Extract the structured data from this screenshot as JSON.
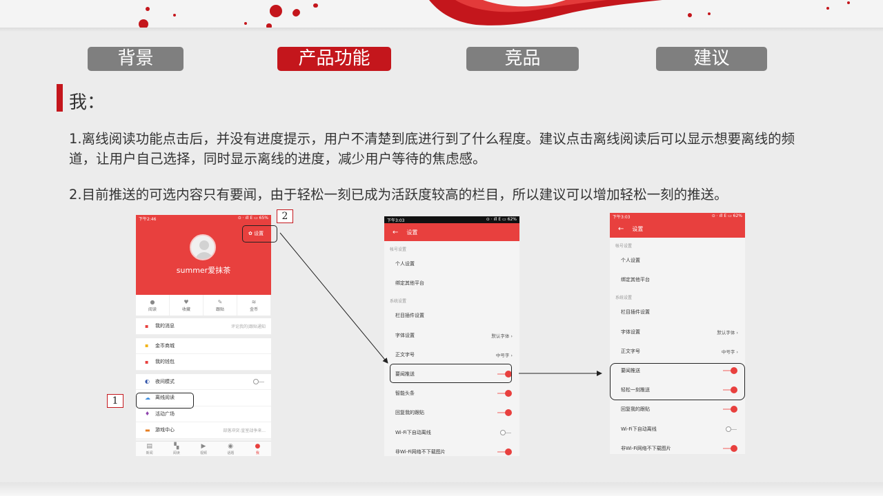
{
  "nav": {
    "tabs": [
      {
        "label": "背景"
      },
      {
        "label": "产品功能"
      },
      {
        "label": "竞品"
      },
      {
        "label": "建议"
      }
    ]
  },
  "section": {
    "title": "我：",
    "paragraphs": [
      "1.离线阅读功能点击后，并没有进度提示，用户不清楚到底进行到了什么程度。建议点击离线阅读后可以显示想要离线的频道，让用户自己选择，同时显示离线的进度，减少用户等待的焦虑感。",
      "2.目前推送的可选内容只有要闻，由于轻松一刻已成为活跃度较高的栏目，所以建议可以增加轻松一刻的推送。"
    ]
  },
  "callouts": {
    "one": "1",
    "two": "2"
  },
  "phone1": {
    "status_left": "下午2:46",
    "status_right": "⊙ ⋅ ıll E ▭ 65%",
    "username": "summer爱抹茶",
    "settings_label": "✿ 设置",
    "quick": [
      {
        "icon": "●",
        "label": "阅读"
      },
      {
        "icon": "♥",
        "label": "收藏"
      },
      {
        "icon": "✎",
        "label": "跟贴"
      },
      {
        "icon": "≋",
        "label": "金币"
      }
    ],
    "menu": [
      {
        "icon": "▪",
        "label": "我的消息",
        "right": "评论我的|跟贴通知"
      },
      {
        "icon": "▪",
        "label": "金币商城",
        "right": ""
      },
      {
        "icon": "▪",
        "label": "我的钱包",
        "right": ""
      },
      {
        "icon": "◐",
        "label": "夜间模式",
        "right": ""
      },
      {
        "icon": "☁",
        "label": "离线阅读",
        "right": ""
      },
      {
        "icon": "♦",
        "label": "活动广场",
        "right": ""
      },
      {
        "icon": "▬",
        "label": "游戏中心",
        "right": "部落冲突:皇室战争来..."
      }
    ],
    "bottom_nav": [
      {
        "icon": "▤",
        "label": "新闻"
      },
      {
        "icon": "▚",
        "label": "阅读"
      },
      {
        "icon": "▶",
        "label": "视频"
      },
      {
        "icon": "◉",
        "label": "话题"
      },
      {
        "icon": "●",
        "label": "我"
      }
    ]
  },
  "phone2": {
    "status_left": "下午3:03",
    "status_right": "⊙ ⋅ ıll E ▭ 62%",
    "title": "设置",
    "group1": "帐号设置",
    "group2": "系统设置",
    "items": [
      {
        "label": "个人设置",
        "right": ""
      },
      {
        "label": "绑定其他平台",
        "right": ""
      },
      {
        "label": "栏目插件设置",
        "right": ""
      },
      {
        "label": "字体设置",
        "right": "默认字体 ›"
      },
      {
        "label": "正文字号",
        "right": "中号字 ›"
      },
      {
        "label": "要闻推送",
        "right": ""
      },
      {
        "label": "智能头条",
        "right": ""
      },
      {
        "label": "回复我的跟贴",
        "right": ""
      },
      {
        "label": "Wi-Fi下自动离线",
        "right": ""
      },
      {
        "label": "非Wi-Fi网络不下载图片",
        "right": ""
      }
    ]
  },
  "phone3": {
    "status_left": "下午3:03",
    "status_right": "⊙ ⋅ ıll E ▭ 62%",
    "title": "设置",
    "group1": "帐号设置",
    "group2": "系统设置",
    "items": [
      {
        "label": "个人设置",
        "right": ""
      },
      {
        "label": "绑定其他平台",
        "right": ""
      },
      {
        "label": "栏目插件设置",
        "right": ""
      },
      {
        "label": "字体设置",
        "right": "默认字体 ›"
      },
      {
        "label": "正文字号",
        "right": "中号字 ›"
      },
      {
        "label": "要闻推送",
        "right": ""
      },
      {
        "label": "轻松一刻推送",
        "right": ""
      },
      {
        "label": "回复我的跟贴",
        "right": ""
      },
      {
        "label": "Wi-Fi下自动离线",
        "right": ""
      },
      {
        "label": "非Wi-Fi网络不下载图片",
        "right": ""
      }
    ]
  }
}
